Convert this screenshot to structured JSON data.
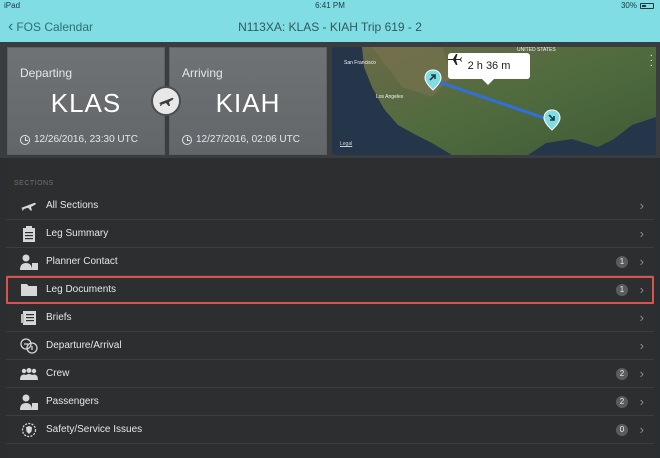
{
  "status_bar": {
    "device": "iPad",
    "time": "6:41 PM",
    "battery": "30%"
  },
  "nav": {
    "back_label": "FOS Calendar",
    "title": "N113XA: KLAS - KIAH  Trip 619 - 2"
  },
  "departing": {
    "label": "Departing",
    "code": "KLAS",
    "time": "12/26/2016, 23:30 UTC"
  },
  "arriving": {
    "label": "Arriving",
    "code": "KIAH",
    "time": "12/27/2016, 02:06 UTC"
  },
  "map": {
    "duration": "2 h 36 m",
    "legal": "Legal",
    "labels": {
      "sf": "San Francisco",
      "la": "Los Angeles",
      "us": "UNITED STATES"
    },
    "accent": "#7fdde3"
  },
  "sections": {
    "header": "SECTIONS",
    "items": [
      {
        "label": "All Sections",
        "icon": "plane-icon",
        "badge": ""
      },
      {
        "label": "Leg Summary",
        "icon": "clipboard-icon",
        "badge": ""
      },
      {
        "label": "Planner Contact",
        "icon": "contact-icon",
        "badge": "1"
      },
      {
        "label": "Leg Documents",
        "icon": "folder-icon",
        "badge": "1"
      },
      {
        "label": "Briefs",
        "icon": "briefs-icon",
        "badge": ""
      },
      {
        "label": "Departure/Arrival",
        "icon": "departure-arrival-icon",
        "badge": ""
      },
      {
        "label": "Crew",
        "icon": "crew-icon",
        "badge": "2"
      },
      {
        "label": "Passengers",
        "icon": "passengers-icon",
        "badge": "2"
      },
      {
        "label": "Safety/Service Issues",
        "icon": "safety-icon",
        "badge": "0"
      }
    ]
  }
}
